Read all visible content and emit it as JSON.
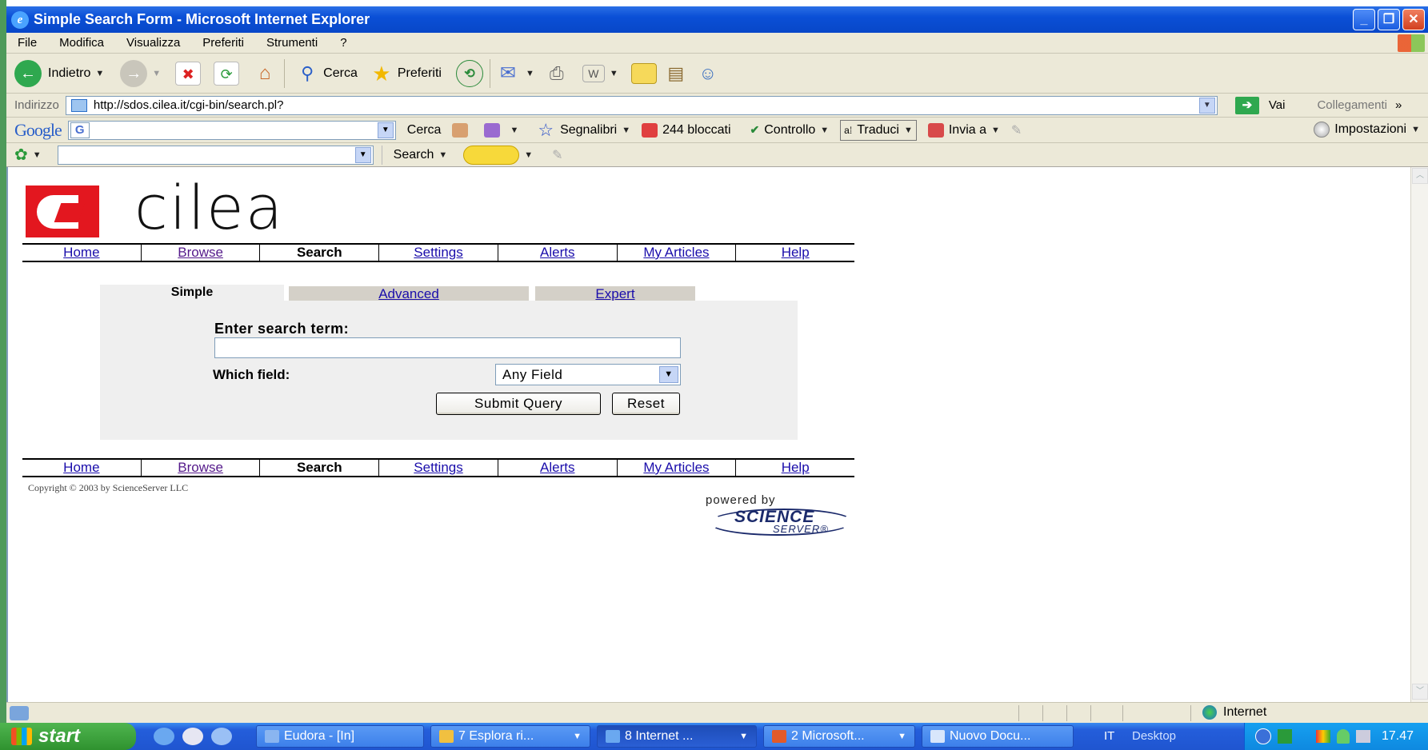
{
  "window": {
    "title": "Simple Search Form - Microsoft Internet Explorer",
    "minimize": "_",
    "restore": "❐",
    "close": "✕"
  },
  "menu": [
    "File",
    "Modifica",
    "Visualizza",
    "Preferiti",
    "Strumenti",
    "?"
  ],
  "toolbar": {
    "back_label": "Indietro",
    "search_label": "Cerca",
    "favorites_label": "Preferiti"
  },
  "address": {
    "label": "Indirizzo",
    "url": "http://sdos.cilea.it/cgi-bin/search.pl?",
    "go_label": "Vai",
    "links_label": "Collegamenti",
    "more": "»"
  },
  "google_bar": {
    "logo": "Google",
    "g_button": "G",
    "search_label": "Cerca",
    "bookmarks_label": "Segnalibri",
    "blocked_label": "244 bloccati",
    "spellcheck_label": "Controllo",
    "translate_label": "Traduci",
    "send_label": "Invia a",
    "settings_label": "Impostazioni"
  },
  "third_bar": {
    "search_label": "Search"
  },
  "page": {
    "logo_text": "cilea",
    "nav": [
      {
        "label": "Home",
        "state": "link"
      },
      {
        "label": "Browse",
        "state": "visited"
      },
      {
        "label": "Search",
        "state": "current"
      },
      {
        "label": "Settings",
        "state": "link"
      },
      {
        "label": "Alerts",
        "state": "link"
      },
      {
        "label": "My Articles",
        "state": "link"
      },
      {
        "label": "Help",
        "state": "link"
      }
    ],
    "tabs": {
      "simple": "Simple",
      "advanced": "Advanced",
      "expert": "Expert"
    },
    "form": {
      "term_label": "Enter search term:",
      "term_value": "",
      "field_label": "Which field:",
      "field_value": "Any Field",
      "submit_label": "Submit Query",
      "reset_label": "Reset"
    },
    "copyright": "Copyright © 2003 by ScienceServer LLC",
    "powered_by": "powered by",
    "ss_logo_line1": "SCIENCE",
    "ss_logo_line2": "SERVER®"
  },
  "status": {
    "zone": "Internet"
  },
  "taskbar": {
    "start": "start",
    "tasks": [
      "Eudora - [In]",
      "7 Esplora ri...",
      "8 Internet ...",
      "2 Microsoft...",
      "Nuovo Docu..."
    ],
    "lang": "IT",
    "desktop": "Desktop",
    "clock": "17.47"
  },
  "colors": {
    "link": "#1a0dab",
    "visited": "#551a8b",
    "cilea_red": "#e3171f",
    "xp_blue": "#0a4fd6"
  }
}
